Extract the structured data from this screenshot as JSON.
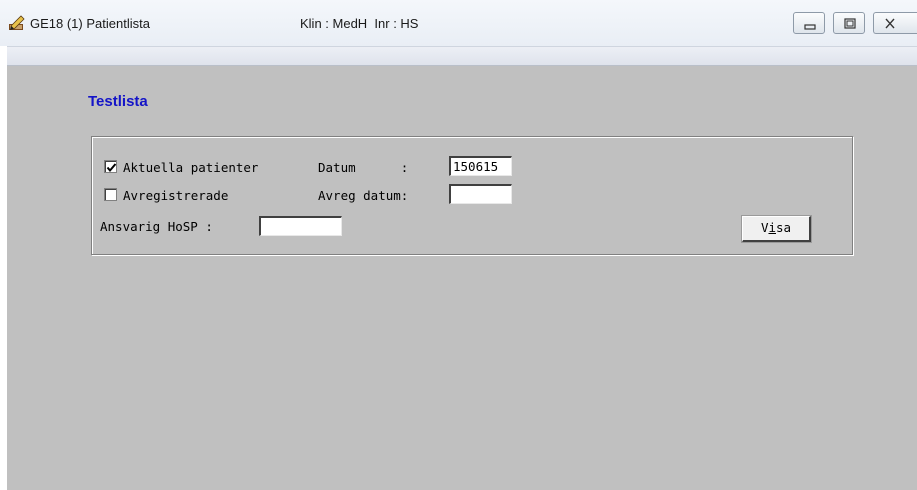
{
  "window": {
    "title": "GE18 (1) Patientlista",
    "subtitle": "Klin : MedH  Inr : HS",
    "icon": "pen-edit-icon",
    "controls": [
      "minimize-icon",
      "restore-icon",
      "close-icon"
    ]
  },
  "form": {
    "heading": "Testlista",
    "aktuella": {
      "label": "Aktuella patienter",
      "checked": true
    },
    "avregistrerade": {
      "label": "Avregistrerade",
      "checked": false
    },
    "datum": {
      "label": "Datum      :",
      "value": "150615"
    },
    "avreg_datum": {
      "label": "Avreg datum:",
      "value": ""
    },
    "ansvarig": {
      "label": "Ansvarig HoSP :",
      "value": ""
    },
    "visa_button": {
      "pre": "V",
      "accel": "i",
      "post": "sa"
    }
  },
  "colors": {
    "client_bg": "#c0c0c0",
    "heading": "#1414c8"
  }
}
